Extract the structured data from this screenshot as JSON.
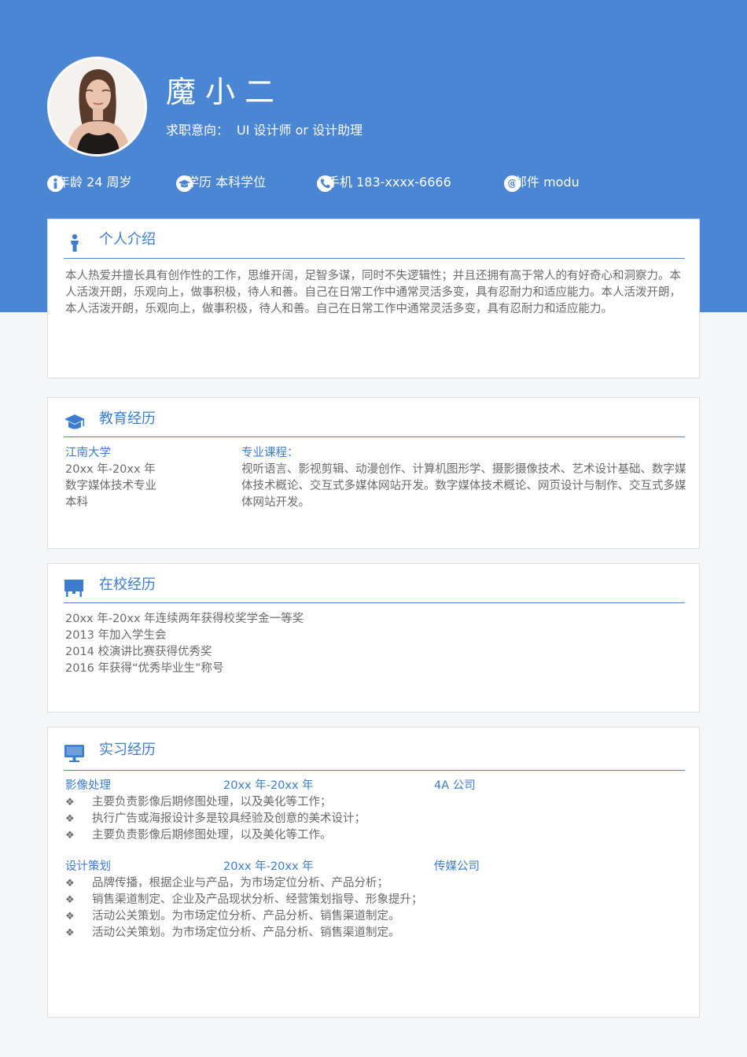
{
  "profile": {
    "name": "魔小二",
    "intent_label": "求职意向：",
    "intent_value": "UI 设计师 or  设计助理"
  },
  "info": [
    {
      "icon": "person-icon",
      "text": "年龄 24 周岁"
    },
    {
      "icon": "graduation-cap-icon",
      "text": "学历 本科学位"
    },
    {
      "icon": "phone-icon",
      "text": "手机 183-xxxx-6666"
    },
    {
      "icon": "at-icon",
      "text": "邮件 modu"
    }
  ],
  "intro": {
    "title": "个人介绍",
    "icon": "person-icon",
    "text": "本人热爱并擅长具有创作性的工作，思维开阔，足智多谋，同时不失逻辑性；并且还拥有高于常人的有好奇心和洞察力。本人活泼开朗，乐观向上，做事积极，待人和善。自己在日常工作中通常灵活多变，具有忍耐力和适应能力。本人活泼开朗，本人活泼开朗，乐观向上，做事积极，待人和善。自己在日常工作中通常灵活多变，具有忍耐力和适应能力。"
  },
  "education": {
    "title": "教育经历",
    "icon": "graduation-cap-icon",
    "school": "江南大学",
    "period": "20xx 年-20xx 年",
    "major": "数字媒体技术专业",
    "degree": "本科",
    "courses_label": "专业课程：",
    "courses": "视听语言、影视剪辑、动漫创作、计算机图形学、摄影摄像技术、艺术设计基础、数字媒体技术概论、交互式多媒体网站开发。数字媒体技术概论、网页设计与制作、交互式多媒体网站开发。"
  },
  "campus": {
    "title": "在校经历",
    "icon": "presentation-board-icon",
    "items": [
      "20xx 年-20xx 年连续两年获得校奖学金一等奖",
      "2013 年加入学生会",
      "2014 校演讲比赛获得优秀奖",
      "2016 年获得“优秀毕业生”称号"
    ]
  },
  "internship": {
    "title": "实习经历",
    "icon": "monitor-icon",
    "bullet": "❖",
    "jobs": [
      {
        "role": "影像处理",
        "period": "20xx 年-20xx 年",
        "company": "4A 公司",
        "duties": [
          "主要负责影像后期修图处理，以及美化等工作；",
          "执行广告或海报设计多是较具经验及创意的美术设计；",
          "主要负责影像后期修图处理，以及美化等工作。"
        ]
      },
      {
        "role": "设计策划",
        "period": "20xx 年-20xx 年",
        "company": "传媒公司",
        "duties": [
          "品牌传播，根据企业与产品，为市场定位分析、产品分析；",
          "销售渠道制定、企业及产品现状分析、经营策划指导、形象提升；",
          "活动公关策划。为市场定位分析、产品分析、销售渠道制定。",
          "活动公关策划。为市场定位分析、产品分析、销售渠道制定。"
        ]
      }
    ]
  },
  "colors": {
    "accent": "#4a86d4",
    "title_blue": "#3d7dce",
    "text_gray": "#6a6a6a"
  }
}
